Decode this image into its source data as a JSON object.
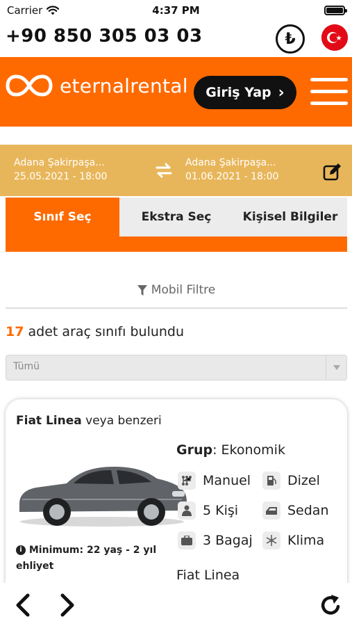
{
  "status_bar": {
    "carrier": "Carrier",
    "time": "4:37 PM",
    "battery_level": 1.0
  },
  "phone_row": {
    "phone_number": "+90 850 305 03 03",
    "currency_symbol": "₺"
  },
  "header": {
    "brand": "eternalrental",
    "login_label": "Giriş Yap",
    "login_chevron": "›",
    "background_color": "#ff6a00"
  },
  "reservation": {
    "pickup_location": "Adana Şakirpaşa...",
    "pickup_datetime": "25.05.2021 - 18:00",
    "return_location": "Adana Şakirpaşa...",
    "return_datetime": "01.06.2021 - 18:00",
    "background_color": "#e8b65a"
  },
  "tabs": [
    {
      "label": "Sınıf Seç",
      "active": true
    },
    {
      "label": "Ekstra Seç",
      "active": false
    },
    {
      "label": "Kişisel Bilgiler",
      "active": false
    }
  ],
  "filter": {
    "label": "Mobil Filtre"
  },
  "results": {
    "count": "17",
    "suffix": "adet araç sınıfı bulundu"
  },
  "class_select": {
    "value": "Tümü"
  },
  "car": {
    "name": "Fiat Linea",
    "name_suffix": "veya benzeri",
    "group_label": "Grup",
    "group_value": "Ekonomik",
    "features": [
      {
        "icon": "gearbox-icon",
        "label": "Manuel"
      },
      {
        "icon": "fuel-icon",
        "label": "Dizel"
      },
      {
        "icon": "person-icon",
        "label": "5 Kişi"
      },
      {
        "icon": "car-body-icon",
        "label": "Sedan"
      },
      {
        "icon": "luggage-icon",
        "label": "3 Bagaj"
      },
      {
        "icon": "snowflake-icon",
        "label": "Klima"
      }
    ],
    "min_requirement": "Minimum: 22 yaş - 2 yıl ehliyet",
    "model_line": "Fiat Linea"
  },
  "toolbar": {
    "back_icon": "chevron-left-icon",
    "forward_icon": "chevron-right-icon",
    "reload_icon": "reload-icon"
  }
}
